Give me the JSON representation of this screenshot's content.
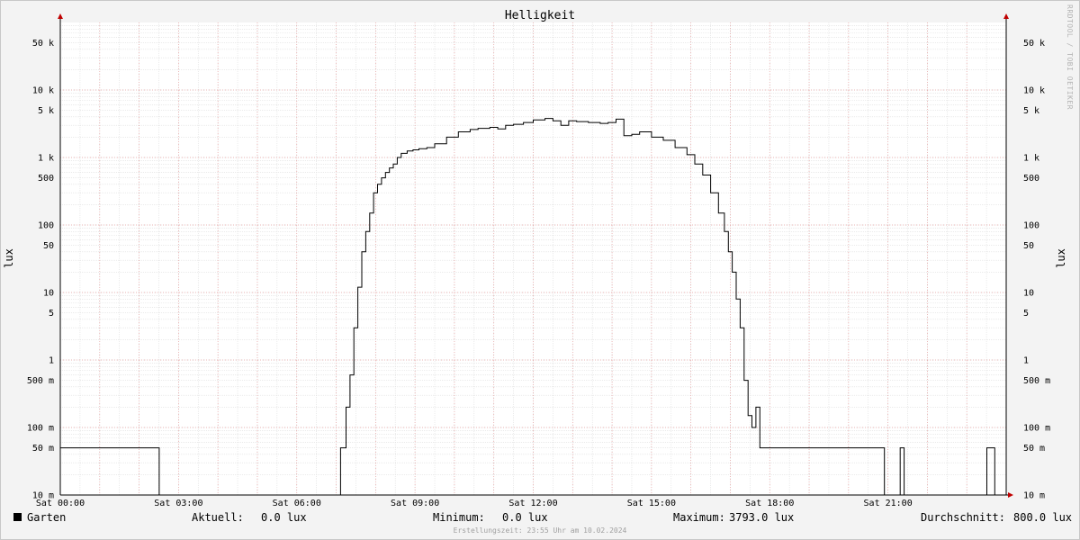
{
  "chart_data": {
    "type": "line",
    "title": "Helligkeit",
    "ylabel": "lux",
    "y_scale": "log",
    "ylim": [
      0.01,
      100000
    ],
    "y_ticks": [
      {
        "value": 0.01,
        "label": "10 m"
      },
      {
        "value": 0.05,
        "label": "50 m"
      },
      {
        "value": 0.1,
        "label": "100 m"
      },
      {
        "value": 0.5,
        "label": "500 m"
      },
      {
        "value": 1,
        "label": "1"
      },
      {
        "value": 5,
        "label": "5"
      },
      {
        "value": 10,
        "label": "10"
      },
      {
        "value": 50,
        "label": "50"
      },
      {
        "value": 100,
        "label": "100"
      },
      {
        "value": 500,
        "label": "500"
      },
      {
        "value": 1000,
        "label": "1 k"
      },
      {
        "value": 5000,
        "label": "5 k"
      },
      {
        "value": 10000,
        "label": "10 k"
      },
      {
        "value": 50000,
        "label": "50 k"
      }
    ],
    "x_unit": "hours",
    "xlim": [
      0,
      24
    ],
    "x_ticks": [
      {
        "value": 0,
        "label": "Sat 00:00"
      },
      {
        "value": 3,
        "label": "Sat 03:00"
      },
      {
        "value": 6,
        "label": "Sat 06:00"
      },
      {
        "value": 9,
        "label": "Sat 09:00"
      },
      {
        "value": 12,
        "label": "Sat 12:00"
      },
      {
        "value": 15,
        "label": "Sat 15:00"
      },
      {
        "value": 18,
        "label": "Sat 18:00"
      },
      {
        "value": 21,
        "label": "Sat 21:00"
      }
    ],
    "grid": true,
    "series": [
      {
        "name": "Garten",
        "color": "#000000",
        "x": [
          0.0,
          2.5,
          2.51,
          7.1,
          7.11,
          7.25,
          7.35,
          7.45,
          7.55,
          7.65,
          7.75,
          7.85,
          7.95,
          8.05,
          8.15,
          8.25,
          8.35,
          8.45,
          8.55,
          8.65,
          8.8,
          8.95,
          9.1,
          9.3,
          9.5,
          9.8,
          10.1,
          10.4,
          10.6,
          10.9,
          11.1,
          11.3,
          11.5,
          11.75,
          12.0,
          12.3,
          12.5,
          12.7,
          12.9,
          13.1,
          13.4,
          13.7,
          13.9,
          14.1,
          14.3,
          14.5,
          14.7,
          15.0,
          15.3,
          15.6,
          15.9,
          16.1,
          16.3,
          16.5,
          16.7,
          16.85,
          16.95,
          17.05,
          17.15,
          17.25,
          17.35,
          17.45,
          17.55,
          17.65,
          17.75,
          17.82,
          17.9,
          17.95,
          18.0,
          18.05,
          18.1,
          18.2,
          18.25,
          18.3,
          20.9,
          20.91,
          21.3,
          21.31,
          21.4,
          21.41,
          23.5,
          23.51,
          23.7,
          23.71,
          23.8
        ],
        "y": [
          0.05,
          0.05,
          0.0,
          0.0,
          0.05,
          0.2,
          0.6,
          3,
          12,
          40,
          80,
          150,
          300,
          400,
          500,
          600,
          700,
          800,
          1000,
          1150,
          1250,
          1300,
          1350,
          1400,
          1600,
          2000,
          2400,
          2600,
          2700,
          2800,
          2650,
          3000,
          3100,
          3300,
          3600,
          3793,
          3500,
          3000,
          3500,
          3400,
          3300,
          3200,
          3300,
          3700,
          2100,
          2200,
          2400,
          2000,
          1800,
          1400,
          1100,
          800,
          550,
          300,
          150,
          80,
          40,
          20,
          8,
          3,
          0.5,
          0.15,
          0.1,
          0.2,
          0.05,
          0.05,
          0.05,
          0.05,
          0.05,
          0.05,
          0.05,
          0.05,
          0.05,
          0.05,
          0.05,
          0.0,
          0.0,
          0.05,
          0.05,
          0.0,
          0.0,
          0.05,
          0.05,
          0.0,
          0.0
        ]
      }
    ]
  },
  "legend": {
    "series_name": "Garten",
    "current_label": "Aktuell:",
    "current_value": "0.0 lux",
    "min_label": "Minimum:",
    "min_value": "0.0 lux",
    "max_label": "Maximum:",
    "max_value": "3793.0 lux",
    "avg_label": "Durchschnitt:",
    "avg_value": "800.0 lux"
  },
  "footer": "Erstellungszeit: 23:55 Uhr am 10.02.2024",
  "watermark": "RRDTOOL / TOBI OETIKER"
}
